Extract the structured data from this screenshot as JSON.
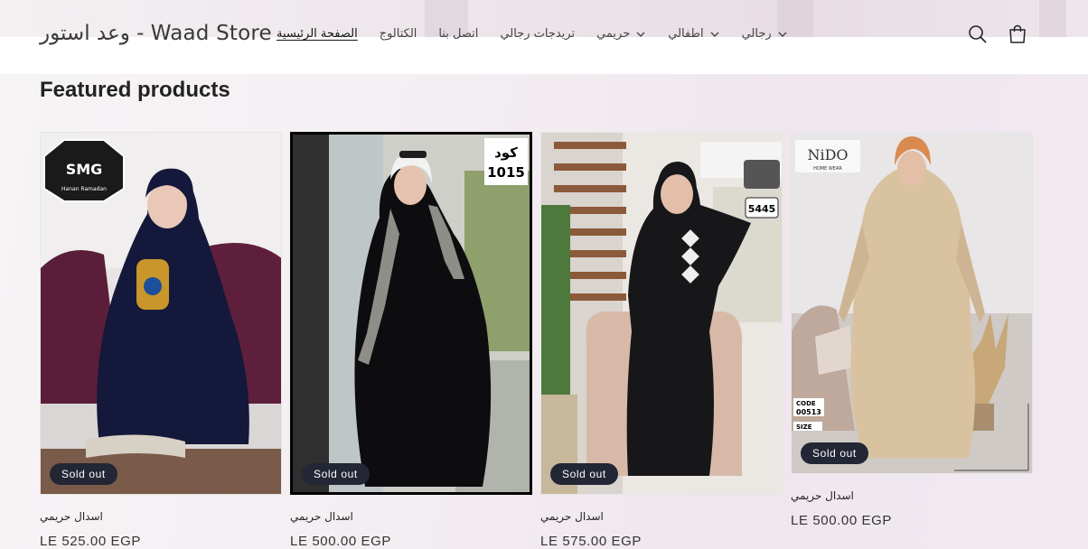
{
  "header": {
    "logo": "وعد استور - Waad Store",
    "nav": [
      {
        "label": "الصفحة الرئيسية",
        "dropdown": false,
        "active": true
      },
      {
        "label": "الكتالوج",
        "dropdown": false,
        "active": false
      },
      {
        "label": "اتصل بنا",
        "dropdown": false,
        "active": false
      },
      {
        "label": "تريدجات رجالي",
        "dropdown": false,
        "active": false
      },
      {
        "label": "حريمي",
        "dropdown": true,
        "active": false
      },
      {
        "label": "اطفالي",
        "dropdown": true,
        "active": false
      },
      {
        "label": "رجالي",
        "dropdown": true,
        "active": false
      }
    ]
  },
  "section": {
    "title": "Featured products"
  },
  "products": [
    {
      "name": "اسدال حريمي",
      "price": "LE 525.00 EGP",
      "badge": "Sold out",
      "overlay": {
        "brand": "SMG",
        "sub": "Hanan Ramadan"
      }
    },
    {
      "name": "اسدال حريمي",
      "price": "LE 500.00 EGP",
      "badge": "Sold out",
      "overlay": {
        "label": "كود",
        "code": "1015"
      }
    },
    {
      "name": "اسدال حريمي",
      "price": "LE 575.00 EGP",
      "badge": "Sold out",
      "overlay": {
        "code": "5445"
      }
    },
    {
      "name": "اسدال حريمي",
      "price": "LE 500.00 EGP",
      "badge": "Sold out",
      "overlay": {
        "brand": "NiDO",
        "sub": "HOME WEAR",
        "code_label": "CODE",
        "code": "00513",
        "size_label": "SIZE"
      }
    }
  ],
  "colors": {
    "badge": "#232634",
    "accent": "#121212"
  }
}
